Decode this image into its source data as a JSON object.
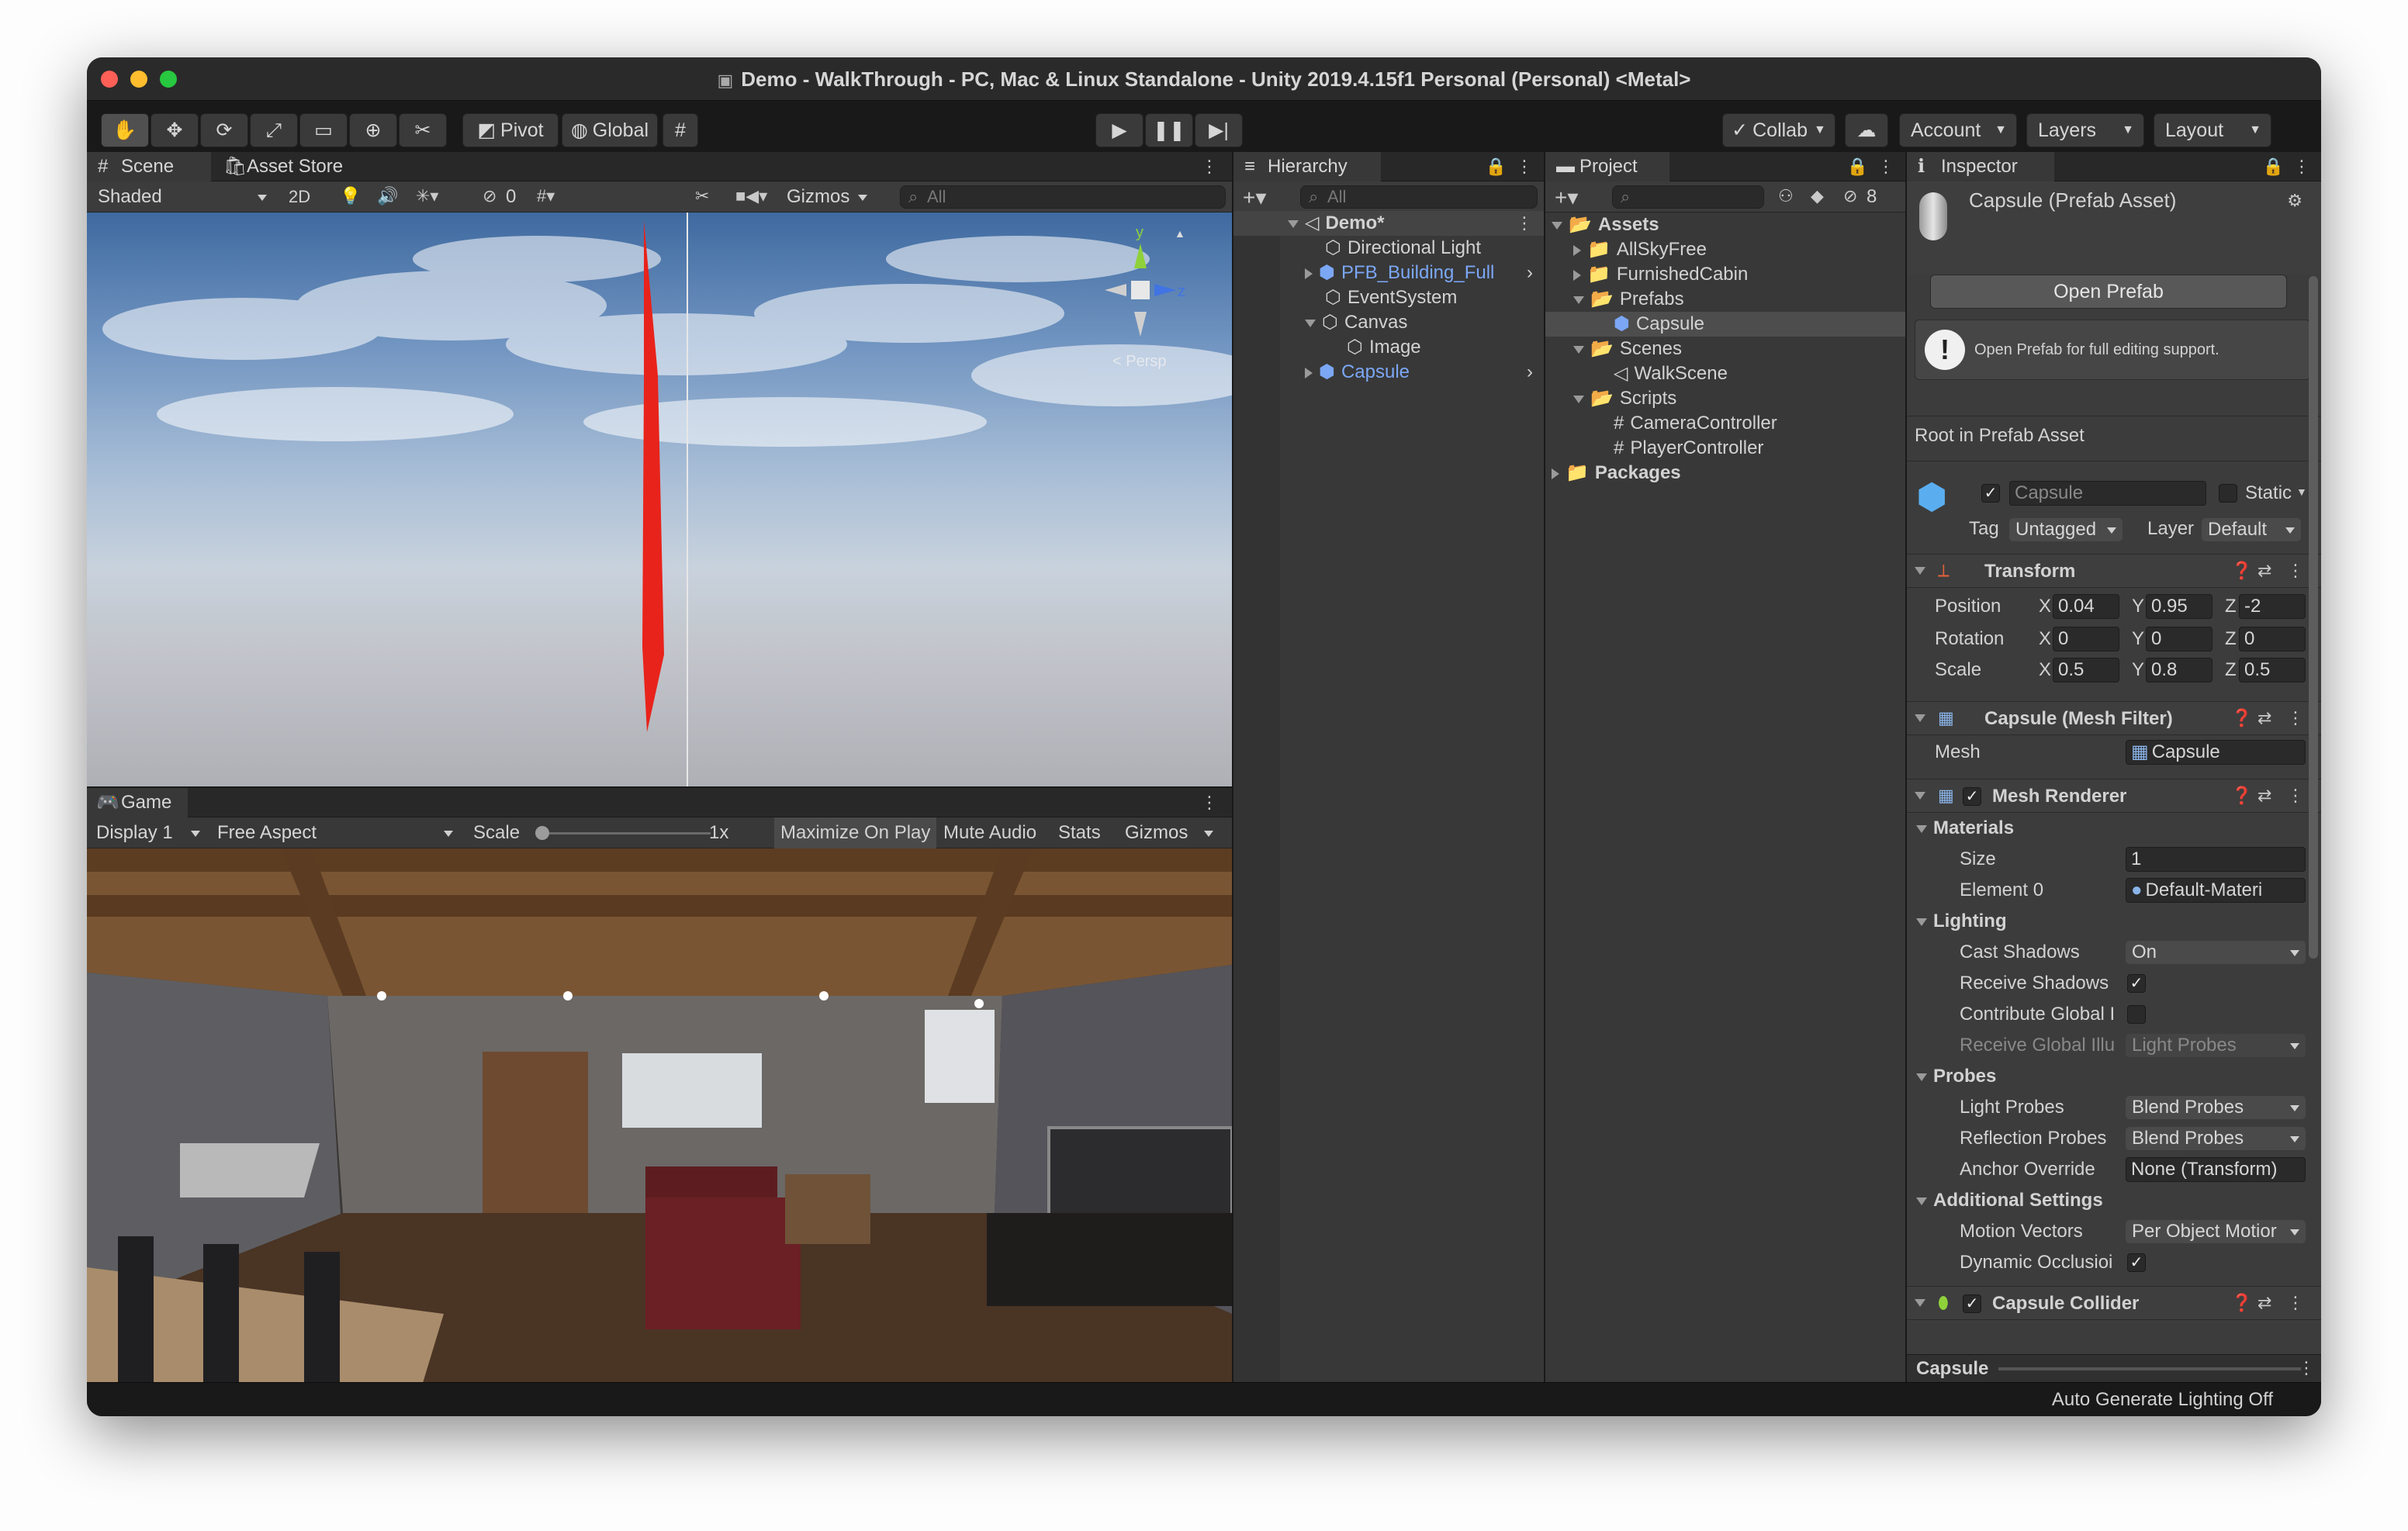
{
  "window": {
    "title": "Demo - WalkThrough - PC, Mac & Linux Standalone - Unity 2019.4.15f1 Personal (Personal) <Metal>"
  },
  "toolbar": {
    "pivot": "Pivot",
    "global": "Global",
    "collab": "Collab",
    "account": "Account",
    "layers": "Layers",
    "layout": "Layout"
  },
  "scene": {
    "tab_scene": "Scene",
    "tab_asset_store": "Asset Store",
    "shading": "Shaded",
    "mode_2d": "2D",
    "hidden_count": "0",
    "gizmos": "Gizmos",
    "search_placeholder": "All",
    "persp_label": "< Persp",
    "axis_y": "y",
    "axis_z": "z"
  },
  "game": {
    "tab": "Game",
    "display": "Display 1",
    "aspect": "Free Aspect",
    "scale_label": "Scale",
    "scale_value": "1x",
    "maximize": "Maximize On Play",
    "mute": "Mute Audio",
    "stats": "Stats",
    "gizmos": "Gizmos"
  },
  "hierarchy": {
    "tab": "Hierarchy",
    "search_placeholder": "All",
    "scene_name": "Demo*",
    "items": [
      {
        "label": "Directional Light"
      },
      {
        "label": "PFB_Building_Full"
      },
      {
        "label": "EventSystem"
      },
      {
        "label": "Canvas"
      },
      {
        "label": "Image"
      },
      {
        "label": "Capsule"
      }
    ]
  },
  "project": {
    "tab": "Project",
    "hidden_count": "8",
    "items": [
      {
        "label": "Assets"
      },
      {
        "label": "AllSkyFree"
      },
      {
        "label": "FurnishedCabin"
      },
      {
        "label": "Prefabs"
      },
      {
        "label": "Capsule"
      },
      {
        "label": "Scenes"
      },
      {
        "label": "WalkScene"
      },
      {
        "label": "Scripts"
      },
      {
        "label": "CameraController"
      },
      {
        "label": "PlayerController"
      },
      {
        "label": "Packages"
      }
    ]
  },
  "inspector": {
    "tab": "Inspector",
    "asset_title": "Capsule (Prefab Asset)",
    "open_prefab": "Open Prefab",
    "info": "Open Prefab for full editing support.",
    "root_label": "Root in Prefab Asset",
    "object_name": "Capsule",
    "static_label": "Static",
    "tag_label": "Tag",
    "tag_value": "Untagged",
    "layer_label": "Layer",
    "layer_value": "Default",
    "transform": {
      "title": "Transform",
      "position_label": "Position",
      "rotation_label": "Rotation",
      "scale_label": "Scale",
      "x": "X",
      "y": "Y",
      "z": "Z",
      "position": [
        "0.04",
        "0.95",
        "-2"
      ],
      "rotation": [
        "0",
        "0",
        "0"
      ],
      "scale": [
        "0.5",
        "0.8",
        "0.5"
      ]
    },
    "mesh_filter": {
      "title": "Capsule (Mesh Filter)",
      "mesh_label": "Mesh",
      "mesh_value": "Capsule"
    },
    "mesh_renderer": {
      "title": "Mesh Renderer",
      "materials": "Materials",
      "size_label": "Size",
      "size_value": "1",
      "element0_label": "Element 0",
      "element0_value": "Default-Materi",
      "lighting": "Lighting",
      "cast_shadows_label": "Cast Shadows",
      "cast_shadows_value": "On",
      "receive_shadows_label": "Receive Shadows",
      "contribute_gi_label": "Contribute Global I",
      "receive_gi_label": "Receive Global Illu",
      "receive_gi_value": "Light Probes",
      "probes": "Probes",
      "light_probes_label": "Light Probes",
      "light_probes_value": "Blend Probes",
      "reflection_probes_label": "Reflection Probes",
      "reflection_probes_value": "Blend Probes",
      "anchor_override_label": "Anchor Override",
      "anchor_override_value": "None (Transform)",
      "additional_settings": "Additional Settings",
      "motion_vectors_label": "Motion Vectors",
      "motion_vectors_value": "Per Object Motior",
      "dynamic_occlusion_label": "Dynamic Occlusioi"
    },
    "capsule_collider": {
      "title": "Capsule Collider"
    },
    "footer_label": "Capsule"
  },
  "status": {
    "text": "Auto Generate Lighting Off"
  },
  "colors": {
    "accent_blue": "#7ba7f5",
    "selection": "#2c5d87",
    "red_object": "#e8231b"
  }
}
